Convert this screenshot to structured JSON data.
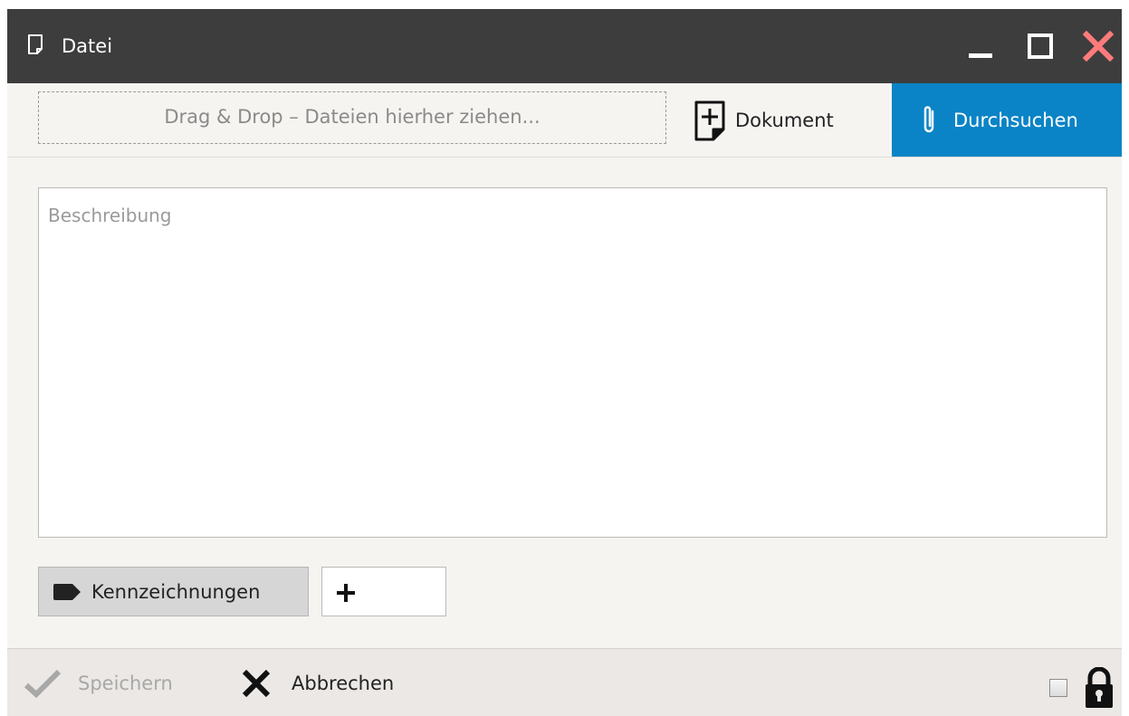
{
  "window": {
    "title": "Datei",
    "icons": {
      "title": "document-icon",
      "minimize": "minimize-icon",
      "maximize": "maximize-icon",
      "close": "close-icon"
    },
    "colors": {
      "titlebar": "#3d3d3d",
      "close": "#ff7b7b"
    }
  },
  "upload": {
    "dropzone_text": "Drag & Drop – Dateien hierher ziehen...",
    "document_label": "Dokument",
    "document_icon": "add-document-icon",
    "browse_label": "Durchsuchen",
    "browse_icon": "paperclip-icon",
    "browse_color": "#0a84c6"
  },
  "description": {
    "placeholder": "Beschreibung",
    "value": ""
  },
  "tags": {
    "label": "Kennzeichnungen",
    "icon": "tag-icon",
    "add_icon": "plus-icon"
  },
  "footer": {
    "save_label": "Speichern",
    "save_icon": "checkmark-icon",
    "cancel_label": "Abbrechen",
    "cancel_icon": "x-icon",
    "lock_icon": "lock-icon",
    "lock_checked": false
  }
}
